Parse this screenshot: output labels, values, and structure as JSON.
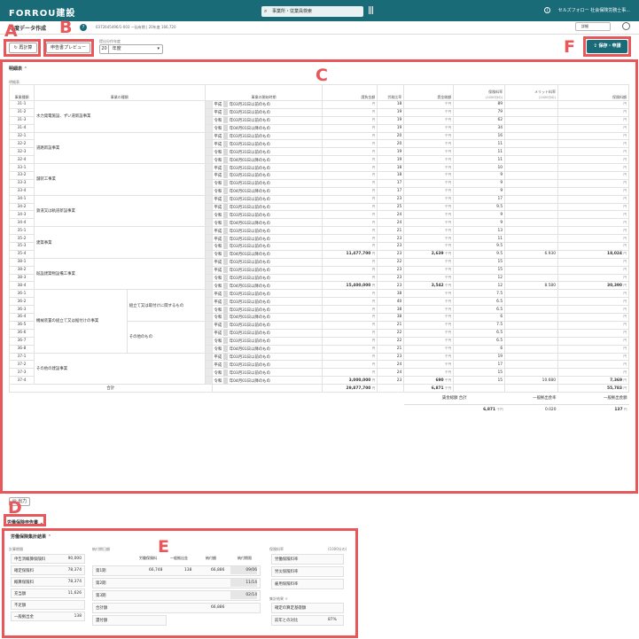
{
  "app": {
    "logo": "FORROU建設",
    "search_placeholder": "事業所・従業員検索",
    "user": "セルズフォロー 社会保険労務士事..."
  },
  "page": {
    "title": "年度データ作成",
    "meta": "0372645496/1-003 一括有期 | 20年度 166,720",
    "version_select": "詳細"
  },
  "toolbar": {
    "recalc_label": "再計算",
    "preview_label": "申告書プレビュー",
    "year_label": "提出分作年度",
    "year_era": "20",
    "year_suffix": "年度",
    "save_label": "保存・申請"
  },
  "annotations": {
    "a": "A",
    "b": "B",
    "c": "C",
    "d": "D",
    "e": "E",
    "f": "F"
  },
  "detail": {
    "section_title": "明細表",
    "sub_label": "明細表",
    "headers": {
      "code": "事業種類",
      "type": "事業の種類",
      "period": "事業の開始時期",
      "contract": "請負金額",
      "rate": "労務比率",
      "wage": "賃金総額",
      "ins_rate": "保険料率",
      "ins_rate_sub": "(1000分の)",
      "merit": "メリット料率",
      "merit_sub": "(1000分の)",
      "premium": "保険料額"
    },
    "eras": {
      "heisei": "平成",
      "reiwa": "令和"
    },
    "periods": {
      "p1": "年03月31日以前のもの",
      "p2": "年04月01日以降のもの"
    },
    "units": {
      "yen": "円",
      "thousand": "千円"
    },
    "groups": [
      {
        "name": "水力発電施設、ずい道新設事業",
        "rows": [
          [
            "31-1",
            "平成",
            "年03月31日以前のもの",
            "",
            "18",
            "",
            "89",
            "",
            ""
          ],
          [
            "31-2",
            "平成",
            "年03月31日以前のもの",
            "",
            "19",
            "",
            "79",
            "",
            ""
          ],
          [
            "31-3",
            "令和",
            "年03月31日以前のもの",
            "",
            "19",
            "",
            "62",
            "",
            ""
          ],
          [
            "31-4",
            "令和",
            "年04月01日以降のもの",
            "",
            "19",
            "",
            "34",
            "",
            ""
          ]
        ]
      },
      {
        "name": "道路新設事業",
        "rows": [
          [
            "32-1",
            "平成",
            "年03月31日以前のもの",
            "",
            "20",
            "",
            "16",
            "",
            ""
          ],
          [
            "32-2",
            "平成",
            "年03月31日以前のもの",
            "",
            "20",
            "",
            "11",
            "",
            ""
          ],
          [
            "32-3",
            "令和",
            "年03月31日以前のもの",
            "",
            "19",
            "",
            "11",
            "",
            ""
          ],
          [
            "32-4",
            "令和",
            "年04月01日以降のもの",
            "",
            "19",
            "",
            "11",
            "",
            ""
          ]
        ]
      },
      {
        "name": "舗装工事業",
        "rows": [
          [
            "33-1",
            "平成",
            "年03月31日以前のもの",
            "",
            "18",
            "",
            "10",
            "",
            ""
          ],
          [
            "33-2",
            "平成",
            "年03月31日以前のもの",
            "",
            "18",
            "",
            "9",
            "",
            ""
          ],
          [
            "33-3",
            "令和",
            "年03月31日以前のもの",
            "",
            "17",
            "",
            "9",
            "",
            ""
          ],
          [
            "33-4",
            "令和",
            "年04月01日以降のもの",
            "",
            "17",
            "",
            "9",
            "",
            ""
          ]
        ]
      },
      {
        "name": "鉄道又は軌道新設事業",
        "rows": [
          [
            "34-1",
            "平成",
            "年03月31日以前のもの",
            "",
            "23",
            "",
            "17",
            "",
            ""
          ],
          [
            "34-2",
            "平成",
            "年03月31日以前のもの",
            "",
            "25",
            "",
            "9.5",
            "",
            ""
          ],
          [
            "34-3",
            "令和",
            "年03月31日以前のもの",
            "",
            "24",
            "",
            "9",
            "",
            ""
          ],
          [
            "34-4",
            "令和",
            "年04月01日以降のもの",
            "",
            "24",
            "",
            "9",
            "",
            ""
          ]
        ]
      },
      {
        "name": "建築事業",
        "rows": [
          [
            "35-1",
            "平成",
            "年03月31日以前のもの",
            "",
            "21",
            "",
            "13",
            "",
            ""
          ],
          [
            "35-2",
            "平成",
            "年03月31日以前のもの",
            "",
            "23",
            "",
            "11",
            "",
            ""
          ],
          [
            "35-3",
            "令和",
            "年03月31日以前のもの",
            "",
            "23",
            "",
            "9.5",
            "",
            ""
          ],
          [
            "35-4",
            "令和",
            "年04月01日以降のもの",
            "11,477,700",
            "23",
            "2,639",
            "9.5",
            "6.930",
            "18,024"
          ]
        ]
      },
      {
        "name": "既設建築物設備工事業",
        "rows": [
          [
            "38-1",
            "平成",
            "年03月31日以前のもの",
            "",
            "22",
            "",
            "15",
            "",
            ""
          ],
          [
            "38-2",
            "平成",
            "年03月31日以前のもの",
            "",
            "23",
            "",
            "15",
            "",
            ""
          ],
          [
            "38-3",
            "令和",
            "年03月31日以前のもの",
            "",
            "23",
            "",
            "12",
            "",
            ""
          ],
          [
            "38-4",
            "令和",
            "年04月01日以降のもの",
            "15,400,000",
            "23",
            "3,542",
            "12",
            "8.580",
            "30,390"
          ]
        ]
      },
      {
        "name": "機械装置の組立て又は据付けの事業",
        "sub": [
          {
            "name": "組立て又は取付けに関するもの",
            "rows": [
              [
                "36-1",
                "平成",
                "年03月31日以前のもの",
                "",
                "38",
                "",
                "7.5",
                "",
                ""
              ],
              [
                "36-2",
                "平成",
                "年03月31日以前のもの",
                "",
                "40",
                "",
                "6.5",
                "",
                ""
              ],
              [
                "36-3",
                "令和",
                "年03月31日以前のもの",
                "",
                "38",
                "",
                "6.5",
                "",
                ""
              ],
              [
                "36-4",
                "令和",
                "年04月01日以降のもの",
                "",
                "38",
                "",
                "6",
                "",
                ""
              ]
            ]
          },
          {
            "name": "その他のもの",
            "rows": [
              [
                "36-5",
                "平成",
                "年03月31日以前のもの",
                "",
                "21",
                "",
                "7.5",
                "",
                ""
              ],
              [
                "36-6",
                "平成",
                "年03月31日以前のもの",
                "",
                "22",
                "",
                "6.5",
                "",
                ""
              ],
              [
                "36-7",
                "令和",
                "年03月31日以前のもの",
                "",
                "22",
                "",
                "6.5",
                "",
                ""
              ],
              [
                "36-8",
                "令和",
                "年04月01日以降のもの",
                "",
                "21",
                "",
                "6",
                "",
                ""
              ]
            ]
          }
        ]
      },
      {
        "name": "その他の建設事業",
        "rows": [
          [
            "37-1",
            "平成",
            "年03月31日以前のもの",
            "",
            "23",
            "",
            "19",
            "",
            ""
          ],
          [
            "37-2",
            "平成",
            "年03月31日以前のもの",
            "",
            "24",
            "",
            "17",
            "",
            ""
          ],
          [
            "37-3",
            "令和",
            "年03月31日以前のもの",
            "",
            "24",
            "",
            "15",
            "",
            ""
          ],
          [
            "37-4",
            "令和",
            "年04月01日以降のもの",
            "3,000,000",
            "23",
            "690",
            "15",
            "10.680",
            "7,369"
          ]
        ]
      }
    ],
    "total_label": "合計",
    "total_contract": "29,877,700",
    "total_wage": "6,871",
    "total_premium": "55,783",
    "summary": {
      "wage_total_label": "賃金総額 合計",
      "general_rate_label": "一般拠出金率",
      "general_amount_label": "一般拠出金額",
      "wage_total": "6,871",
      "general_rate": "0.020",
      "general_amount": "137"
    }
  },
  "output_button": "出力",
  "labor": {
    "section_title": "労働保険申告書",
    "calc_title": "労働保険集計結果",
    "calc": {
      "left_head": "計算期間",
      "left_rows": [
        [
          "申告済概算保険料",
          "90,000"
        ],
        [
          "確定保険料",
          "78,374"
        ],
        [
          "概算保険料",
          "78,374"
        ],
        [
          "充当額",
          "11,626"
        ],
        [
          "不足額",
          ""
        ],
        [
          "一般拠出金",
          "138"
        ]
      ],
      "mid_head": "納付期日額",
      "mid_cols": [
        "労働保険料",
        "一般拠出金",
        "納付額",
        "納付期限"
      ],
      "mid_rows": [
        [
          "第1期",
          "66,748",
          "138",
          "66,886",
          "09/06"
        ],
        [
          "第2期",
          "",
          "",
          "",
          "11/14"
        ],
        [
          "第3期",
          "",
          "",
          "",
          "02/14"
        ],
        [
          "合計額",
          "",
          "",
          "66,886",
          ""
        ]
      ],
      "mid_extra": "還付額",
      "right_head": "保険料率",
      "right_unit": "(1000分の)",
      "right_rows": [
        "労働保険料率",
        "労災保険料率",
        "雇用保険料率"
      ],
      "bottom_head": "集計結果",
      "bottom_rows": [
        "確定の算定基礎額",
        "前年との対比"
      ],
      "ratio": "87%"
    }
  }
}
